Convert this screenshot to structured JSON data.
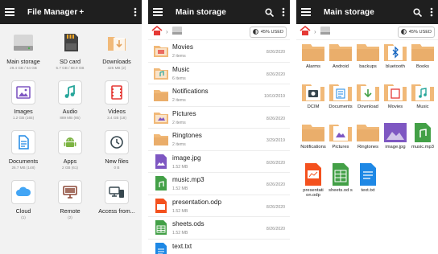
{
  "colors": {
    "appbar": "#1f1f1f",
    "folder": "#f1b978",
    "folder_dark": "#e3a25c",
    "accent_red": "#e53935",
    "purple": "#7e57c2",
    "green": "#43a047",
    "orange": "#f4511e",
    "blue": "#1e88e5"
  },
  "panel1": {
    "title": "File Manager",
    "plus": "+",
    "items": [
      {
        "label": "Main storage",
        "sub": "29.4 GB / 64 GB",
        "icon": "drive-icon"
      },
      {
        "label": "SD card",
        "sub": "5.7 GB / 58.9 GB",
        "icon": "sd-card-icon"
      },
      {
        "label": "Downloads",
        "sub": "425 MB (2)",
        "icon": "downloads-icon"
      },
      {
        "label": "Images",
        "sub": "1.2 GB (165)",
        "icon": "image-icon"
      },
      {
        "label": "Audio",
        "sub": "889 MB (85)",
        "icon": "audio-icon"
      },
      {
        "label": "Videos",
        "sub": "3.4 GB (18)",
        "icon": "video-icon"
      },
      {
        "label": "Documents",
        "sub": "26.7 MB (148)",
        "icon": "document-icon"
      },
      {
        "label": "Apps",
        "sub": "2 GB (61)",
        "icon": "android-icon"
      },
      {
        "label": "New files",
        "sub": "0 B",
        "icon": "clock-icon"
      },
      {
        "label": "Cloud",
        "sub": "(1)",
        "icon": "cloud-icon"
      },
      {
        "label": "Remote",
        "sub": "(2)",
        "icon": "monitor-icon"
      },
      {
        "label": "Access from...",
        "sub": "",
        "icon": "network-icon"
      }
    ]
  },
  "panel2": {
    "title": "Main storage",
    "used": "45% USED",
    "rows": [
      {
        "name": "Movies",
        "meta": "2 items",
        "date": "8/26/2020",
        "icon": "folder-movie-icon"
      },
      {
        "name": "Music",
        "meta": "6 items",
        "date": "8/26/2020",
        "icon": "folder-music-icon"
      },
      {
        "name": "Notifications",
        "meta": "2 items",
        "date": "10/10/2019",
        "icon": "folder-icon"
      },
      {
        "name": "Pictures",
        "meta": "2 items",
        "date": "8/26/2020",
        "icon": "folder-picture-icon"
      },
      {
        "name": "Ringtones",
        "meta": "2 items",
        "date": "3/29/2019",
        "icon": "folder-icon"
      },
      {
        "name": "image.jpg",
        "meta": "1.52 MB",
        "date": "8/26/2020",
        "icon": "image-file-icon"
      },
      {
        "name": "music.mp3",
        "meta": "1.52 MB",
        "date": "8/26/2020",
        "icon": "audio-file-icon"
      },
      {
        "name": "presentation.odp",
        "meta": "1.52 MB",
        "date": "8/26/2020",
        "icon": "presentation-file-icon"
      },
      {
        "name": "sheets.ods",
        "meta": "1.52 MB",
        "date": "8/26/2020",
        "icon": "sheet-file-icon"
      },
      {
        "name": "text.txt",
        "meta": "",
        "date": "",
        "icon": "text-file-icon"
      }
    ]
  },
  "panel3": {
    "title": "Main storage",
    "used": "45% USED",
    "items": [
      {
        "label": "Alarms",
        "icon": "folder-icon"
      },
      {
        "label": "Android",
        "icon": "folder-icon"
      },
      {
        "label": "backups",
        "icon": "folder-icon"
      },
      {
        "label": "bluetooth",
        "icon": "folder-bluetooth-icon"
      },
      {
        "label": "Books",
        "icon": "folder-icon"
      },
      {
        "label": "DCIM",
        "icon": "folder-camera-icon"
      },
      {
        "label": "Documents",
        "icon": "folder-document-icon"
      },
      {
        "label": "Download",
        "icon": "folder-download-icon"
      },
      {
        "label": "Movies",
        "icon": "folder-movie-icon"
      },
      {
        "label": "Music",
        "icon": "folder-music-icon"
      },
      {
        "label": "Notifications",
        "icon": "folder-icon"
      },
      {
        "label": "Pictures",
        "icon": "folder-picture-icon"
      },
      {
        "label": "Ringtones",
        "icon": "folder-icon"
      },
      {
        "label": "image.jpg",
        "icon": "image-file-icon"
      },
      {
        "label": "music.mp3",
        "icon": "audio-file-icon"
      }
    ],
    "files": [
      {
        "label": "presentati on.odp",
        "icon": "presentation-file-icon"
      },
      {
        "label": "sheets.od s",
        "icon": "sheet-file-icon"
      },
      {
        "label": "text.txt",
        "icon": "text-file-icon"
      }
    ]
  }
}
